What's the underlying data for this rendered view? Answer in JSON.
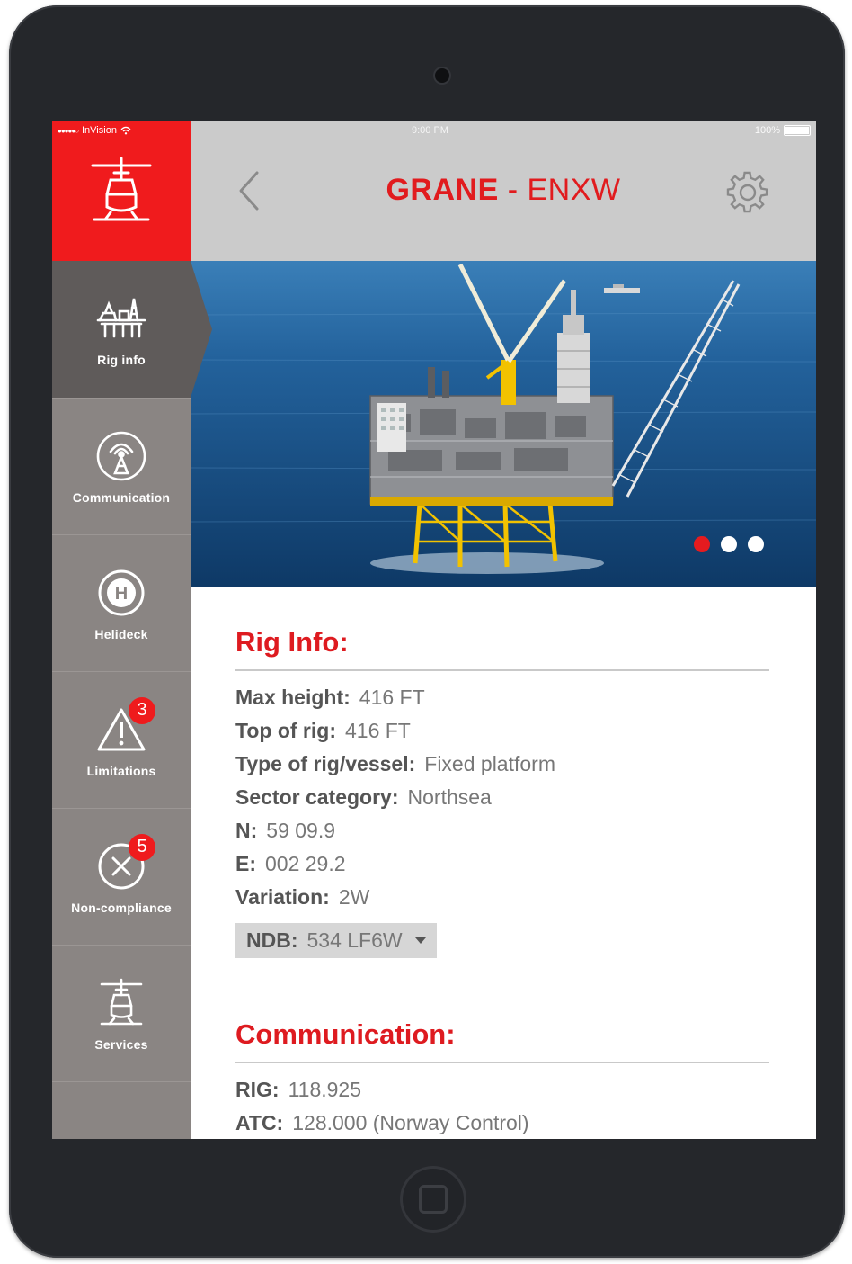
{
  "status_bar": {
    "carrier": "InVision",
    "time": "9:00 PM",
    "battery": "100%"
  },
  "header": {
    "rig_name": "GRANE",
    "separator": " - ",
    "rig_code": "ENXW"
  },
  "sidebar": {
    "items": [
      {
        "label": "Rig info",
        "icon": "oil-rig-icon",
        "active": true
      },
      {
        "label": "Communication",
        "icon": "radio-tower-icon"
      },
      {
        "label": "Helideck",
        "icon": "helipad-icon"
      },
      {
        "label": "Limitations",
        "icon": "warning-icon",
        "badge": "3"
      },
      {
        "label": "Non-compliance",
        "icon": "x-circle-icon",
        "badge": "5"
      },
      {
        "label": "Services",
        "icon": "helicopter-icon"
      }
    ]
  },
  "carousel": {
    "total": 3,
    "active_index": 0
  },
  "rig_info": {
    "title": "Rig Info:",
    "rows": [
      {
        "key": "Max height:",
        "value": "416 FT"
      },
      {
        "key": "Top of rig:",
        "value": "416 FT"
      },
      {
        "key": "Type of rig/vessel:",
        "value": "Fixed platform"
      },
      {
        "key": "Sector category:",
        "value": "Northsea"
      },
      {
        "key": "N:",
        "value": "59 09.9"
      },
      {
        "key": "E:",
        "value": "002 29.2"
      },
      {
        "key": "Variation:",
        "value": "2W"
      }
    ],
    "ndb": {
      "key": "NDB:",
      "value": "534 LF6W"
    }
  },
  "communication": {
    "title": "Communication:",
    "rows": [
      {
        "key": "RIG:",
        "value": "118.925"
      },
      {
        "key": "ATC:",
        "value": "128.000 (Norway Control)"
      }
    ]
  },
  "colors": {
    "accent_red": "#e11b1e",
    "sidebar_gray": "#8a8583",
    "sidebar_active": "#5f5b5a",
    "header_gray": "#cbcbcb"
  }
}
